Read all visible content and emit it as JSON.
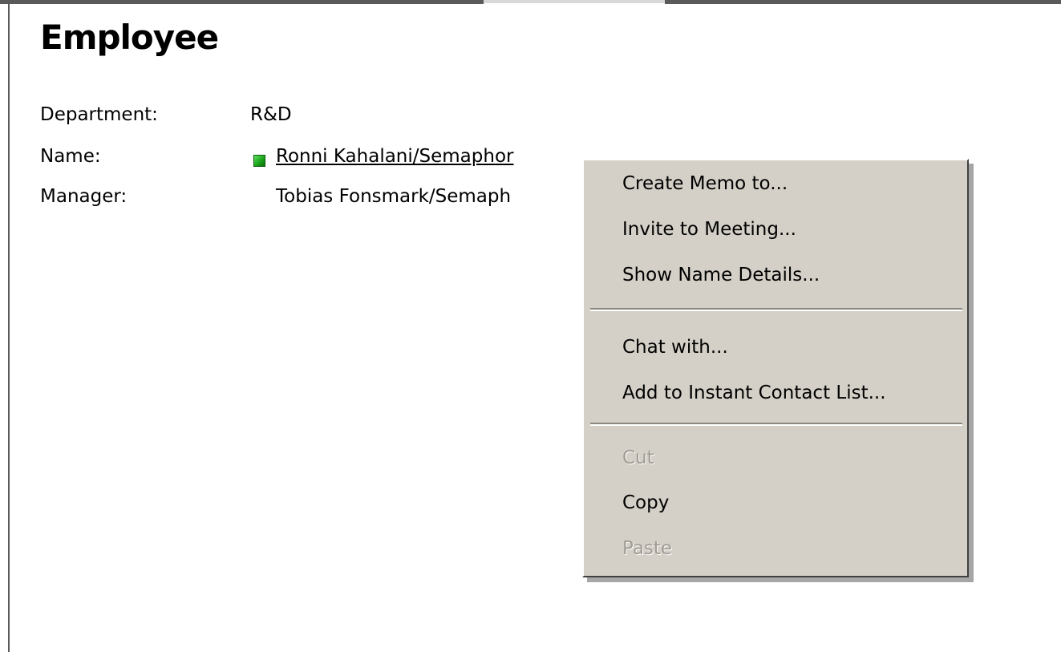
{
  "form": {
    "title": "Employee",
    "fields": {
      "department": {
        "label": "Department:",
        "value": "R&D"
      },
      "name": {
        "label": "Name:",
        "value": "Ronni Kahalani/Semaphor",
        "status_color": "#22b022"
      },
      "manager": {
        "label": "Manager:",
        "value": "Tobias Fonsmark/Semaph"
      }
    }
  },
  "context_menu": {
    "items": [
      {
        "label": "Create Memo to...",
        "enabled": true
      },
      {
        "label": "Invite to Meeting...",
        "enabled": true
      },
      {
        "label": "Show Name Details...",
        "enabled": true
      },
      {
        "label": "Chat with...",
        "enabled": true
      },
      {
        "label": "Add to Instant Contact List...",
        "enabled": true
      },
      {
        "label": "Cut",
        "enabled": false
      },
      {
        "label": "Copy",
        "enabled": true
      },
      {
        "label": "Paste",
        "enabled": false
      }
    ]
  }
}
